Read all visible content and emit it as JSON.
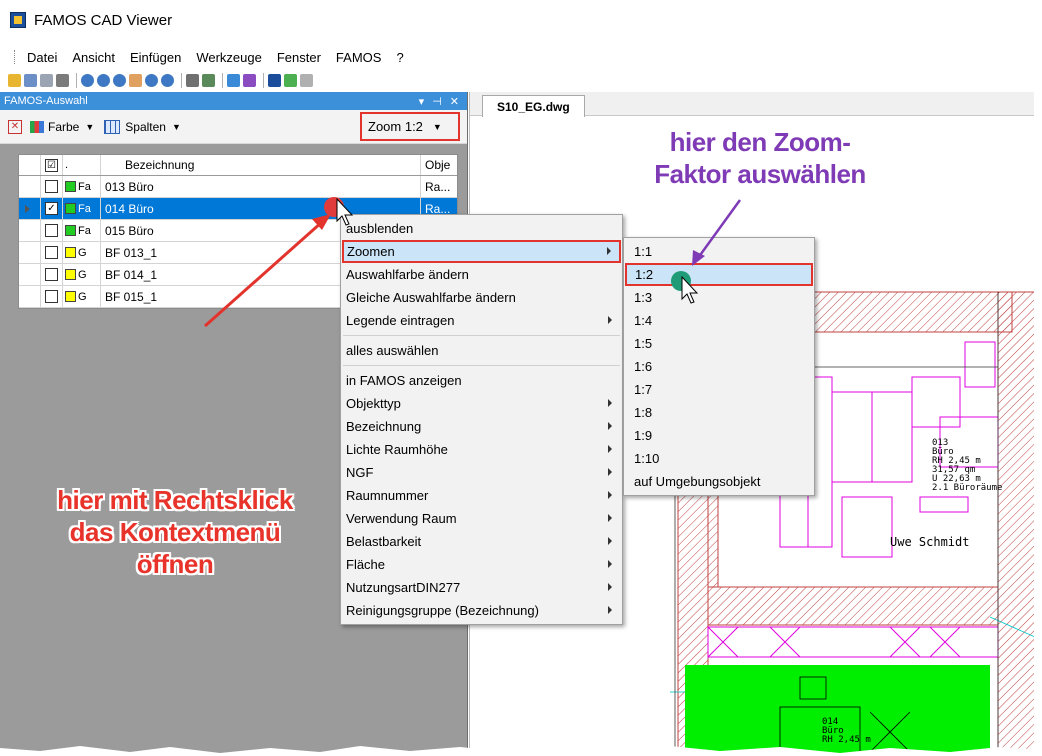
{
  "window": {
    "title": "FAMOS CAD Viewer"
  },
  "menubar": [
    "Datei",
    "Ansicht",
    "Einfügen",
    "Werkzeuge",
    "Fenster",
    "FAMOS",
    "?"
  ],
  "panel": {
    "title": "FAMOS-Auswahl",
    "controls": [
      "▾",
      "⊣",
      "✕"
    ],
    "toolbar": {
      "close": "✕",
      "color_label": "Farbe",
      "columns_label": "Spalten",
      "zoom_label": "Zoom 1:2"
    }
  },
  "grid": {
    "columns": [
      "",
      "☑",
      ".",
      "Bezeichnung",
      "Obje"
    ],
    "rows": [
      {
        "checked": false,
        "color": "#22cc22",
        "type": "Fa",
        "name": "013 Büro",
        "obj": "Ra...",
        "selected": false
      },
      {
        "checked": true,
        "color": "#22cc22",
        "type": "Fa",
        "name": "014 Büro",
        "obj": "Ra...",
        "selected": true
      },
      {
        "checked": false,
        "color": "#22cc22",
        "type": "Fa",
        "name": "015 Büro",
        "obj": "",
        "selected": false
      },
      {
        "checked": false,
        "color": "#ffff00",
        "type": "G",
        "name": "BF 013_1",
        "obj": "",
        "selected": false
      },
      {
        "checked": false,
        "color": "#ffff00",
        "type": "G",
        "name": "BF 014_1",
        "obj": "",
        "selected": false
      },
      {
        "checked": false,
        "color": "#ffff00",
        "type": "G",
        "name": "BF 015_1",
        "obj": "",
        "selected": false
      }
    ]
  },
  "annotations": {
    "left": [
      "hier mit Rechtsklick",
      "das Kontextmenü",
      "öffnen"
    ],
    "right": [
      "hier den Zoom-",
      "Faktor auswählen"
    ]
  },
  "drawing": {
    "tab": "S10_EG.dwg",
    "room013": "013\nBüro\nRH 2,45 m\n31,57 qm\nU 22,63 m\n2.1 Büroräume",
    "room014": "014\nBüro\nRH 2,45 m",
    "person": "Uwe Schmidt"
  },
  "context_menu": {
    "items": [
      {
        "label": "ausblenden",
        "sub": false
      },
      {
        "label": "Zoomen",
        "sub": true,
        "active": true
      },
      {
        "label": "Auswahlfarbe ändern",
        "sub": false
      },
      {
        "label": "Gleiche Auswahlfarbe ändern",
        "sub": false
      },
      {
        "label": "Legende eintragen",
        "sub": true
      },
      {
        "sep": true
      },
      {
        "label": "alles auswählen",
        "sub": false
      },
      {
        "sep": true
      },
      {
        "label": "in FAMOS anzeigen",
        "sub": false
      },
      {
        "label": "Objekttyp",
        "sub": true
      },
      {
        "label": "Bezeichnung",
        "sub": true
      },
      {
        "label": "Lichte Raumhöhe",
        "sub": true
      },
      {
        "label": "NGF",
        "sub": true
      },
      {
        "label": "Raumnummer",
        "sub": true
      },
      {
        "label": "Verwendung Raum",
        "sub": true
      },
      {
        "label": "Belastbarkeit",
        "sub": true
      },
      {
        "label": "Fläche",
        "sub": true
      },
      {
        "label": "NutzungsartDIN277",
        "sub": true
      },
      {
        "label": "Reinigungsgruppe (Bezeichnung)",
        "sub": true
      }
    ]
  },
  "zoom_submenu": {
    "items": [
      "1:1",
      "1:2",
      "1:3",
      "1:4",
      "1:5",
      "1:6",
      "1:7",
      "1:8",
      "1:9",
      "1:10",
      "auf Umgebungsobjekt"
    ],
    "active_index": 1
  },
  "colors": {
    "accent_red": "#e2332c",
    "accent_purple": "#7f3ab6",
    "selection_blue": "#0078d7",
    "cad_magenta": "#e000e0",
    "cad_hatch": "#c04040",
    "room_green": "#00ee00"
  }
}
